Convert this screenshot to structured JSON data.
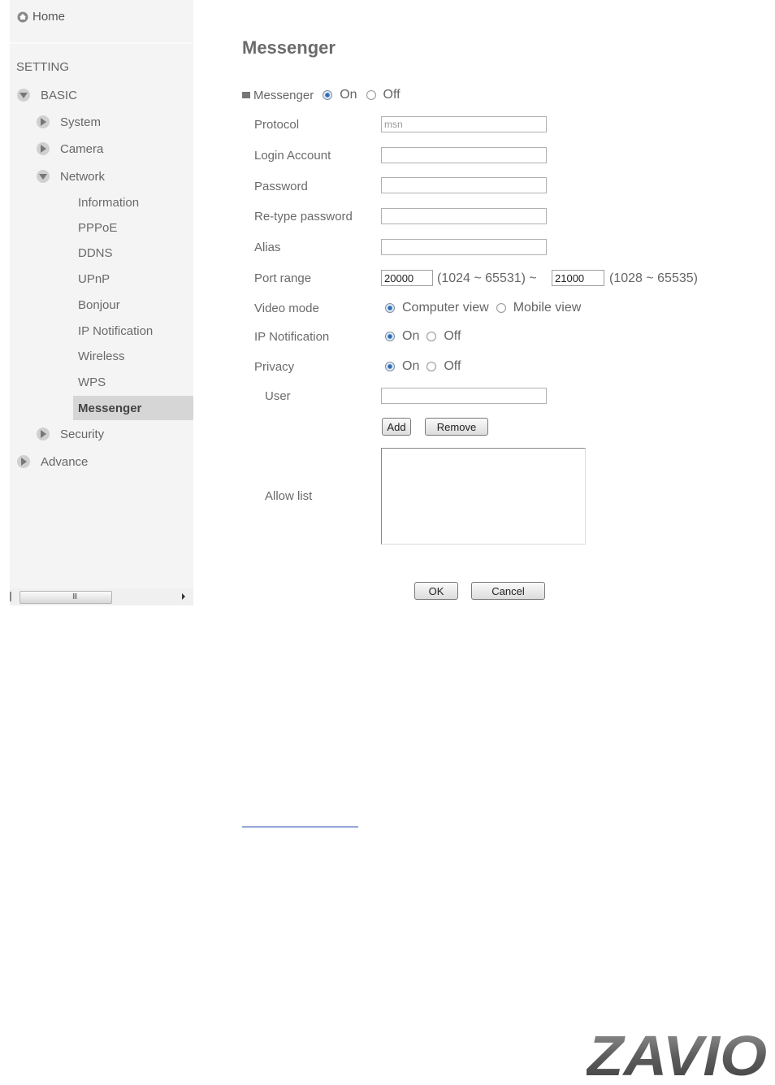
{
  "sidebar": {
    "home_label": "Home",
    "setting_label": "SETTING",
    "basic_label": "BASIC",
    "system_label": "System",
    "camera_label": "Camera",
    "network_label": "Network",
    "network_items": [
      "Information",
      "PPPoE",
      "DDNS",
      "UPnP",
      "Bonjour",
      "IP Notification",
      "Wireless",
      "WPS"
    ],
    "active_item": "Messenger",
    "security_label": "Security",
    "advance_label": "Advance",
    "scroll_grip": "III"
  },
  "main": {
    "title": "Messenger",
    "messenger_label": "Messenger",
    "on_label": "On",
    "off_label": "Off",
    "protocol_label": "Protocol",
    "protocol_value": "msn",
    "login_label": "Login Account",
    "password_label": "Password",
    "retype_label": "Re-type password",
    "alias_label": "Alias",
    "port_label": "Port range",
    "port_from": "20000",
    "port_from_range": "(1024 ~ 65531) ~",
    "port_to": "21000",
    "port_to_range": "(1028 ~ 65535)",
    "video_label": "Video mode",
    "video_computer": "Computer view",
    "video_mobile": "Mobile view",
    "ipnotif_label": "IP Notification",
    "privacy_label": "Privacy",
    "user_label": "User",
    "add_button": "Add",
    "remove_button": "Remove",
    "allow_label": "Allow list",
    "ok_button": "OK",
    "cancel_button": "Cancel"
  },
  "logo_text": "ZAVIO",
  "colors": {
    "sidebar_bg": "#f4f4f4",
    "active_bg": "#d6d6d6",
    "radio_on": "#1f5fa6",
    "link": "#1a3ea8"
  }
}
